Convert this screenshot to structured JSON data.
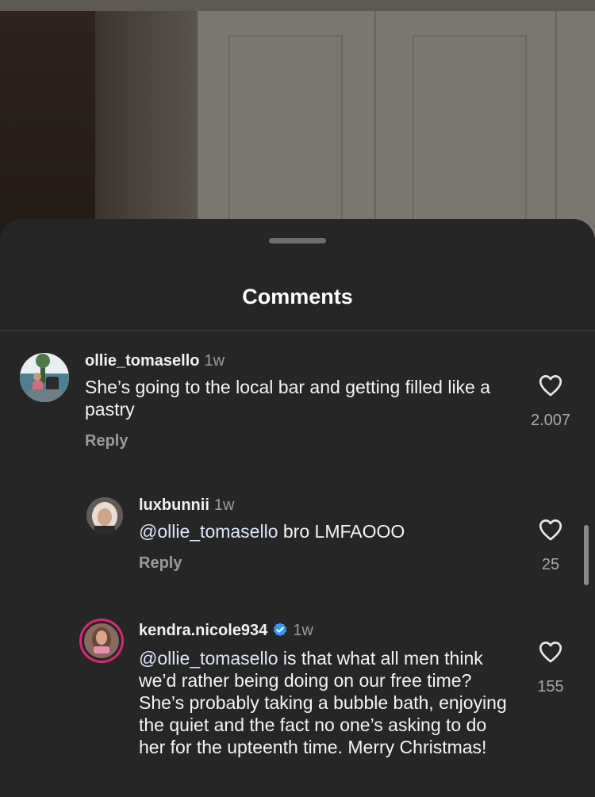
{
  "sheet": {
    "title": "Comments"
  },
  "comments": [
    {
      "username": "ollie_tomasello",
      "time": "1w",
      "text": "She’s going to the local bar and getting filled like a pastry",
      "reply_label": "Reply",
      "likes": "2.007",
      "icon": "heart-outline-icon"
    },
    {
      "username": "luxbunnii",
      "time": "1w",
      "mention": "@ollie_tomasello",
      "text": " bro LMFAOOO",
      "reply_label": "Reply",
      "likes": "25",
      "icon": "heart-outline-icon"
    },
    {
      "username": "kendra.nicole934",
      "verified": true,
      "time": "1w",
      "mention": "@ollie_tomasello",
      "text": " is that what all men think we’d rather being doing on our free time? She’s probably taking a bubble bath, enjoying the quiet and the fact no one’s asking to do her for the upteenth time. Merry Christmas!",
      "likes": "155",
      "icon": "heart-outline-icon"
    }
  ],
  "colors": {
    "sheet": "#262627",
    "verified": "#3897f0",
    "story_ring": "#d62976"
  }
}
